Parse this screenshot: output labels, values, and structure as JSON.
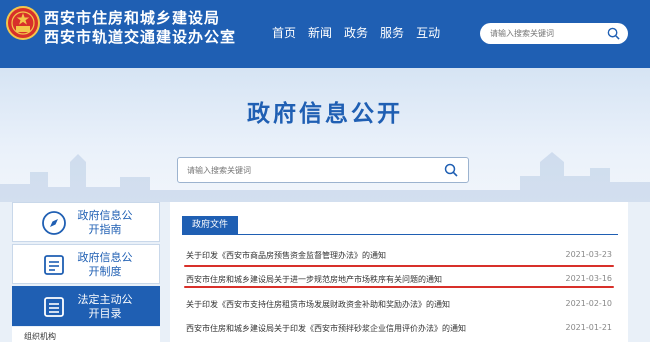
{
  "header": {
    "org_line1": "西安市住房和城乡建设局",
    "org_line2": "西安市轨道交通建设办公室",
    "nav": [
      "首页",
      "新闻",
      "政务",
      "服务",
      "互动"
    ],
    "search_placeholder": "请输入搜索关键词",
    "colors": {
      "bar": "#1f5fb3",
      "text": "#ffffff"
    }
  },
  "banner": {
    "title": "政府信息公开",
    "search_placeholder": "请输入搜索关键词"
  },
  "sidebar": {
    "items": [
      {
        "label": "政府信息公开指南",
        "icon": "compass-icon",
        "active": false
      },
      {
        "label": "政府信息公开制度",
        "icon": "document-icon",
        "active": false
      },
      {
        "label": "法定主动公开目录",
        "icon": "list-icon",
        "active": true
      }
    ],
    "sub_item": "组织机构"
  },
  "main": {
    "section_title": "政府文件",
    "documents": [
      {
        "title": "关于印发《西安市商品房预售资金监督管理办法》的通知",
        "date": "2021-03-23",
        "highlighted": true
      },
      {
        "title": "西安市住房和城乡建设局关于进一步规范房地产市场秩序有关问题的通知",
        "date": "2021-03-16",
        "highlighted": true
      },
      {
        "title": "关于印发《西安市支持住房租赁市场发展财政资金补助和奖励办法》的通知",
        "date": "2021-02-10",
        "highlighted": false
      },
      {
        "title": "西安市住房和城乡建设局关于印发《西安市预拌砂浆企业信用评价办法》的通知",
        "date": "2021-01-21",
        "highlighted": false
      }
    ],
    "highlight_color": "#d8302a"
  }
}
